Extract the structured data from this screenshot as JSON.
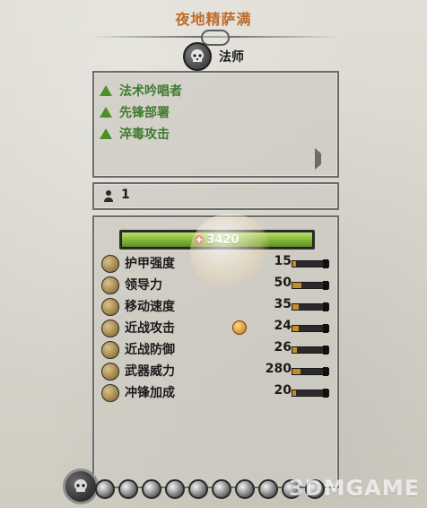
{
  "unit": {
    "title": "夜地精萨满",
    "class_icon": "skull-icon",
    "class": "法师",
    "count": "1"
  },
  "abilities": {
    "items": [
      {
        "label": "法术吟唱者",
        "icon": "up-triangle-icon"
      },
      {
        "label": "先锋部署",
        "icon": "up-triangle-icon"
      },
      {
        "label": "淬毒攻击",
        "icon": "up-triangle-icon"
      }
    ],
    "expand_icon": "triangle-right-icon"
  },
  "health": {
    "value": "3420",
    "fill_fraction": 1.0,
    "icon": "health-cross-icon"
  },
  "stats": [
    {
      "name": "护甲强度",
      "value": "15",
      "bar_fraction": 0.1,
      "icon": "armor-icon"
    },
    {
      "name": "领导力",
      "value": "50",
      "bar_fraction": 0.25,
      "icon": "leadership-icon"
    },
    {
      "name": "移动速度",
      "value": "35",
      "bar_fraction": 0.18,
      "icon": "speed-icon"
    },
    {
      "name": "近战攻击",
      "value": "24",
      "bar_fraction": 0.18,
      "icon": "melee-attack-icon",
      "modifier_icon": "melee-bonus-icon"
    },
    {
      "name": "近战防御",
      "value": "26",
      "bar_fraction": 0.12,
      "icon": "melee-defense-icon"
    },
    {
      "name": "武器威力",
      "value": "280",
      "bar_fraction": 0.22,
      "icon": "weapon-strength-icon"
    },
    {
      "name": "冲锋加成",
      "value": "20",
      "bar_fraction": 0.1,
      "icon": "charge-bonus-icon"
    }
  ],
  "bottom_bar": {
    "badge_icon": "skull-badge-icon",
    "icons": [
      "red-faction-icon",
      "flag-icon",
      "eye-icon",
      "spell-icon",
      "poison-icon",
      "blade-icon",
      "rune-icon",
      "gold-icon",
      "shield-icon",
      "skull-icon"
    ]
  },
  "watermark": "3DMGAME"
}
